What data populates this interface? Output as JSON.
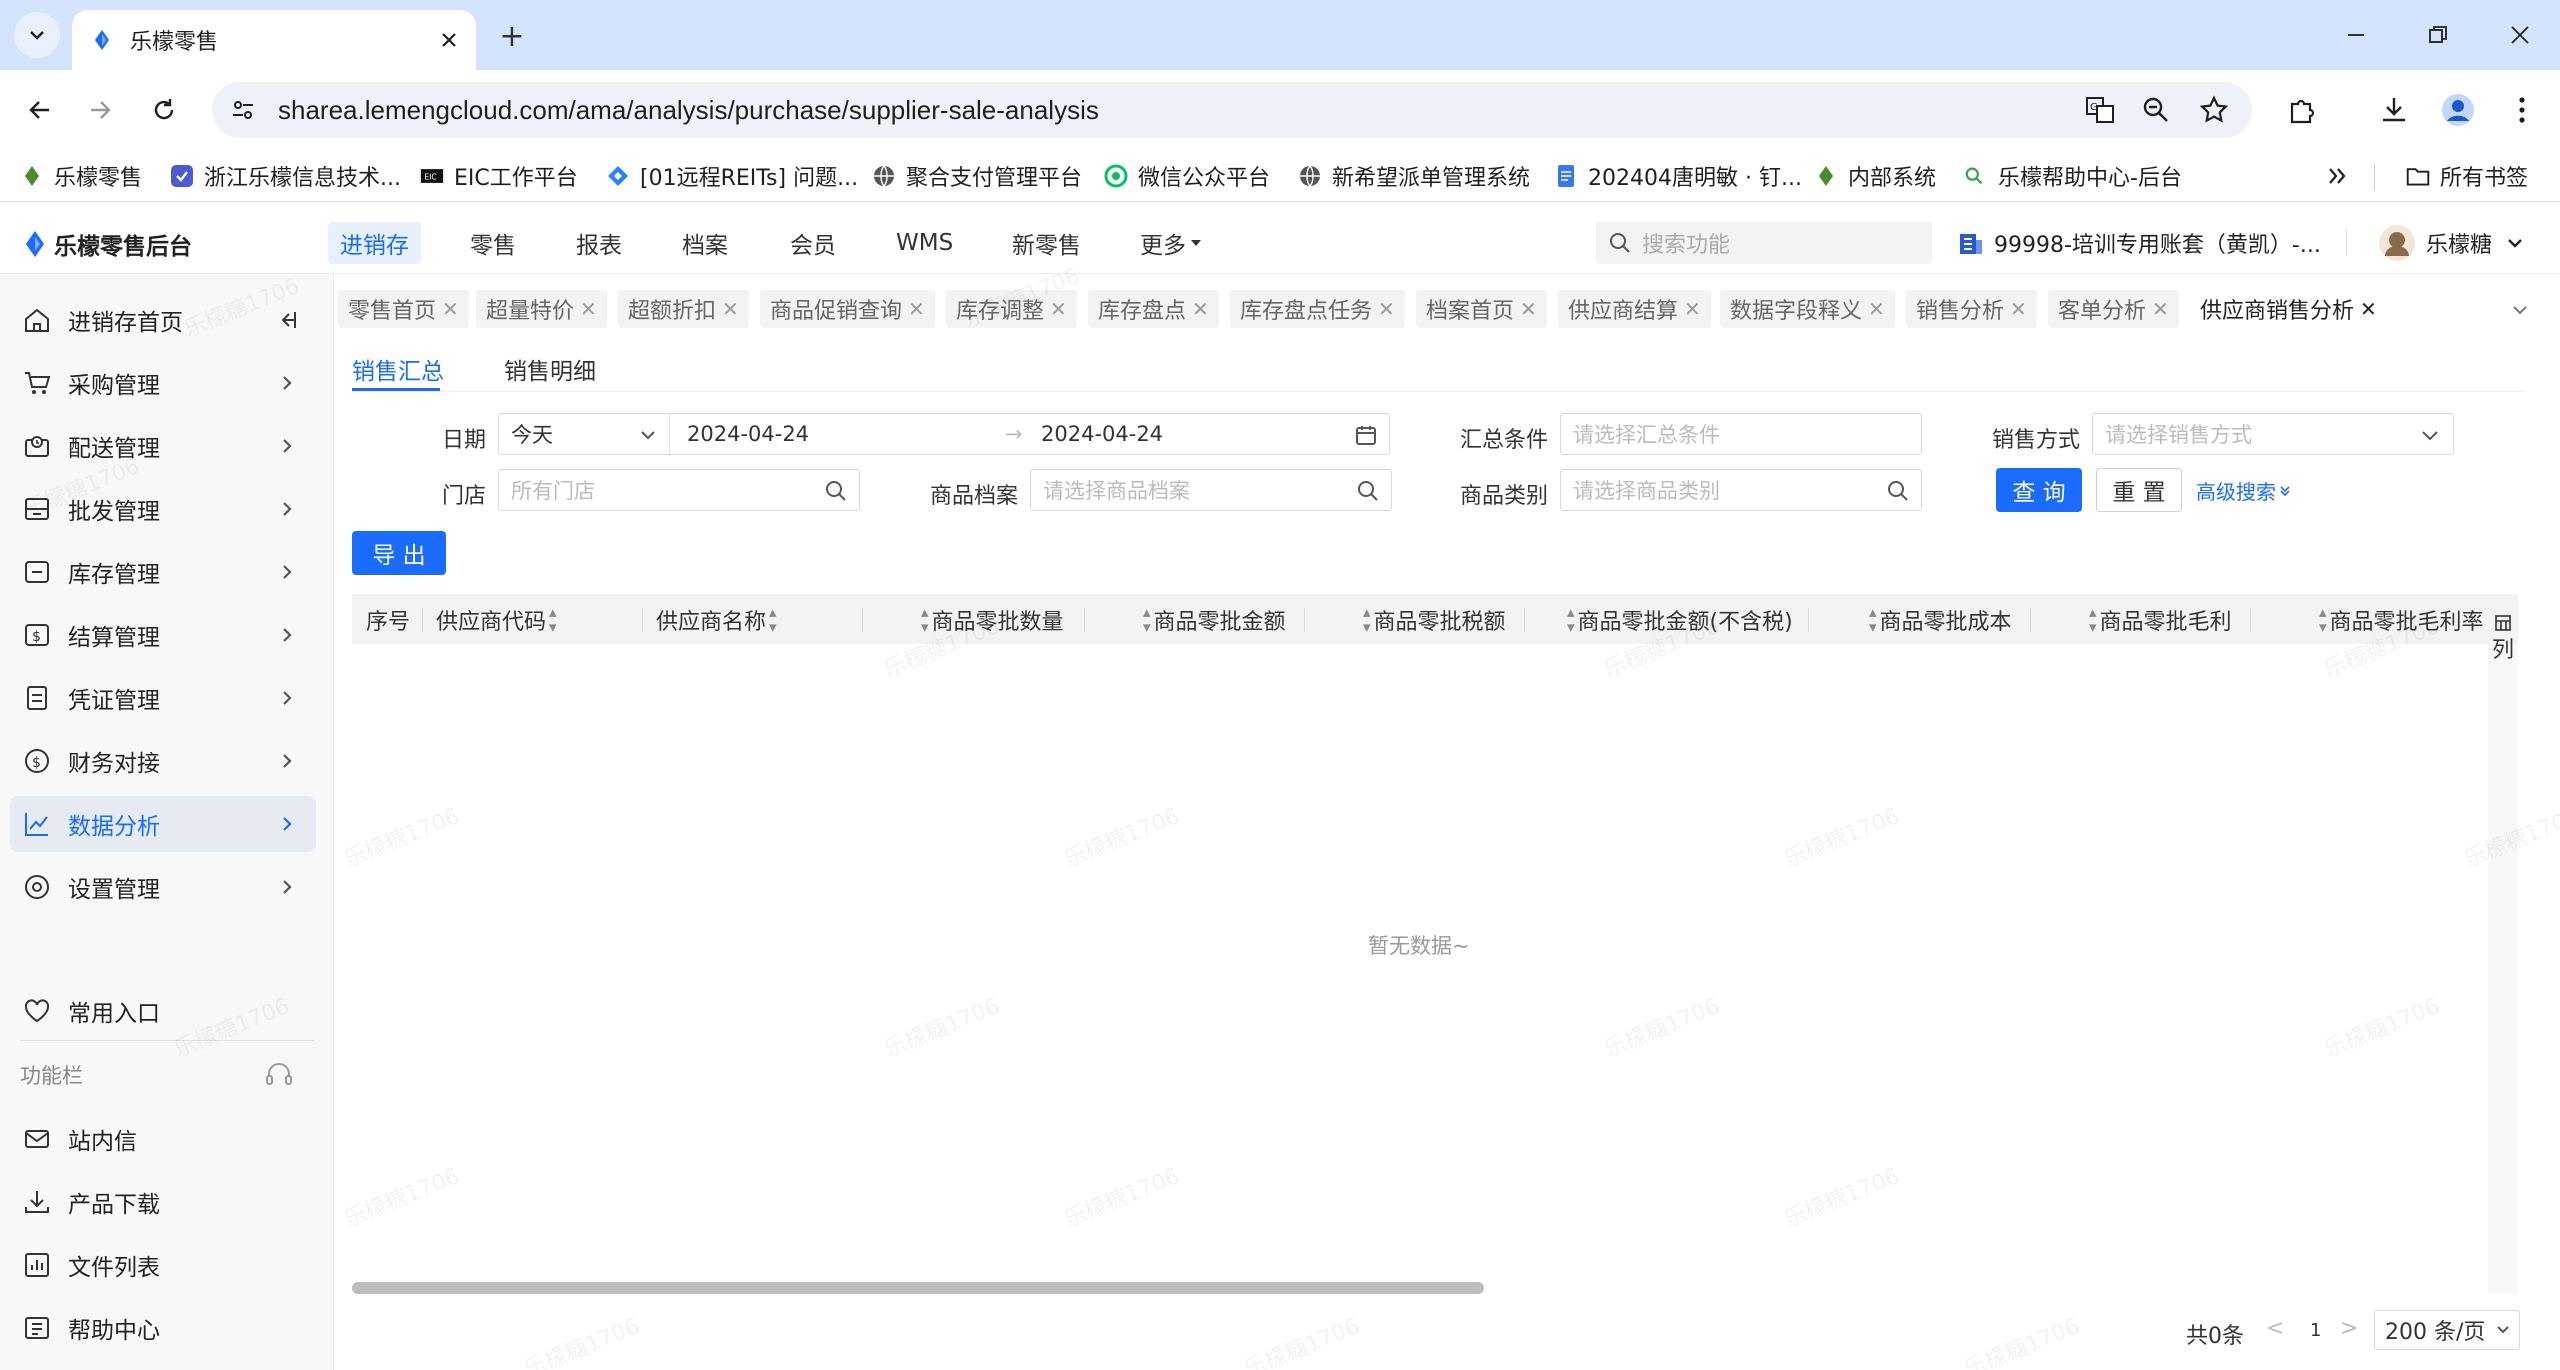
{
  "browser": {
    "tab_title": "乐檬零售",
    "new_tab": "+",
    "url": "sharea.lemengcloud.com/ama/analysis/purchase/supplier-sale-analysis"
  },
  "bookmarks": {
    "items": [
      {
        "label": "乐檬零售",
        "icon": "lemeng-logo-icon"
      },
      {
        "label": "浙江乐檬信息技术...",
        "icon": "lemeng-blue-icon"
      },
      {
        "label": "EIC工作平台",
        "icon": "eic-icon"
      },
      {
        "label": "[01远程REITs] 问题...",
        "icon": "jira-icon"
      },
      {
        "label": "聚合支付管理平台",
        "icon": "globe-icon"
      },
      {
        "label": "微信公众平台",
        "icon": "wechat-icon"
      },
      {
        "label": "新希望派单管理系统",
        "icon": "globe-icon"
      },
      {
        "label": "202404唐明敏 · 钉...",
        "icon": "doc-icon"
      },
      {
        "label": "内部系统",
        "icon": "lemeng-logo-icon"
      },
      {
        "label": "乐檬帮助中心-后台",
        "icon": "seo-icon"
      }
    ],
    "all_bookmarks": "所有书签"
  },
  "app": {
    "logo": "乐檬零售后台",
    "nav": [
      "进销存",
      "零售",
      "报表",
      "档案",
      "会员",
      "WMS",
      "新零售",
      "更多"
    ],
    "search_placeholder": "搜索功能",
    "account": "99998-培训专用账套（黄凯）-...",
    "user": "乐檬糖"
  },
  "sidebar": {
    "items": [
      {
        "label": "进销存首页",
        "icon": "home-icon"
      },
      {
        "label": "采购管理",
        "icon": "cart-icon"
      },
      {
        "label": "配送管理",
        "icon": "delivery-icon"
      },
      {
        "label": "批发管理",
        "icon": "wholesale-icon"
      },
      {
        "label": "库存管理",
        "icon": "inventory-icon"
      },
      {
        "label": "结算管理",
        "icon": "settlement-icon"
      },
      {
        "label": "凭证管理",
        "icon": "voucher-icon"
      },
      {
        "label": "财务对接",
        "icon": "finance-icon"
      },
      {
        "label": "数据分析",
        "icon": "chart-icon"
      },
      {
        "label": "设置管理",
        "icon": "settings-icon"
      }
    ],
    "favorites": "常用入口",
    "function_bar": "功能栏",
    "tools": [
      {
        "label": "站内信",
        "icon": "mail-icon"
      },
      {
        "label": "产品下载",
        "icon": "download-icon"
      },
      {
        "label": "文件列表",
        "icon": "file-list-icon"
      },
      {
        "label": "帮助中心",
        "icon": "help-icon"
      }
    ]
  },
  "page_tabs": [
    "零售首页",
    "超量特价",
    "超额折扣",
    "商品促销查询",
    "库存调整",
    "库存盘点",
    "库存盘点任务",
    "档案首页",
    "供应商结算",
    "数据字段释义",
    "销售分析",
    "客单分析",
    "供应商销售分析"
  ],
  "sub_tabs": [
    "销售汇总",
    "销售明细"
  ],
  "filters": {
    "date_label": "日期",
    "date_preset": "今天",
    "date_start": "2024-04-24",
    "date_sep": "→",
    "date_end": "2024-04-24",
    "summary_label": "汇总条件",
    "summary_placeholder": "请选择汇总条件",
    "sale_mode_label": "销售方式",
    "sale_mode_placeholder": "请选择销售方式",
    "store_label": "门店",
    "store_placeholder": "所有门店",
    "goods_label": "商品档案",
    "goods_placeholder": "请选择商品档案",
    "category_label": "商品类别",
    "category_placeholder": "请选择商品类别",
    "query": "查 询",
    "reset": "重 置",
    "advanced": "高级搜索",
    "export": "导 出"
  },
  "table": {
    "columns": [
      "序号",
      "供应商代码",
      "供应商名称",
      "商品零批数量",
      "商品零批金额",
      "商品零批税额",
      "商品零批金额(不含税)",
      "商品零批成本",
      "商品零批毛利",
      "商品零批毛利率"
    ],
    "column_settings": "列",
    "empty": "暂无数据~"
  },
  "pager": {
    "total": "共0条",
    "prev": "<",
    "page": "1",
    "next": ">",
    "page_size": "200 条/页"
  },
  "watermark": "乐檬糖1706",
  "colors": {
    "primary": "#1a6cff",
    "chrome_tabstrip": "#d3e3fd"
  }
}
